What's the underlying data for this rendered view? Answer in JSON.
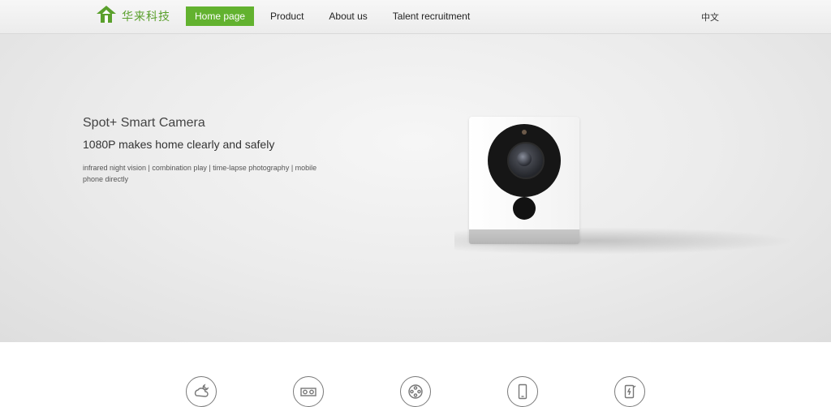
{
  "header": {
    "logo_text": "华来科技",
    "nav": [
      {
        "label": "Home page",
        "active": true
      },
      {
        "label": "Product",
        "active": false
      },
      {
        "label": "About us",
        "active": false
      },
      {
        "label": "Talent recruitment",
        "active": false
      }
    ],
    "language": "中文"
  },
  "hero": {
    "title": "Spot+ Smart Camera",
    "subtitle": "1080P makes home clearly and safely",
    "description": "infrared night vision | combination play | time-lapse photography | mobile phone directly",
    "image": "smart-camera"
  },
  "features": {
    "icons": [
      "cloud-moon-icon",
      "stereo-icon",
      "film-reel-icon",
      "phone-icon",
      "phone-lightning-icon"
    ]
  },
  "colors": {
    "accent": "#62b22f",
    "logo_green": "#5aa02c"
  }
}
